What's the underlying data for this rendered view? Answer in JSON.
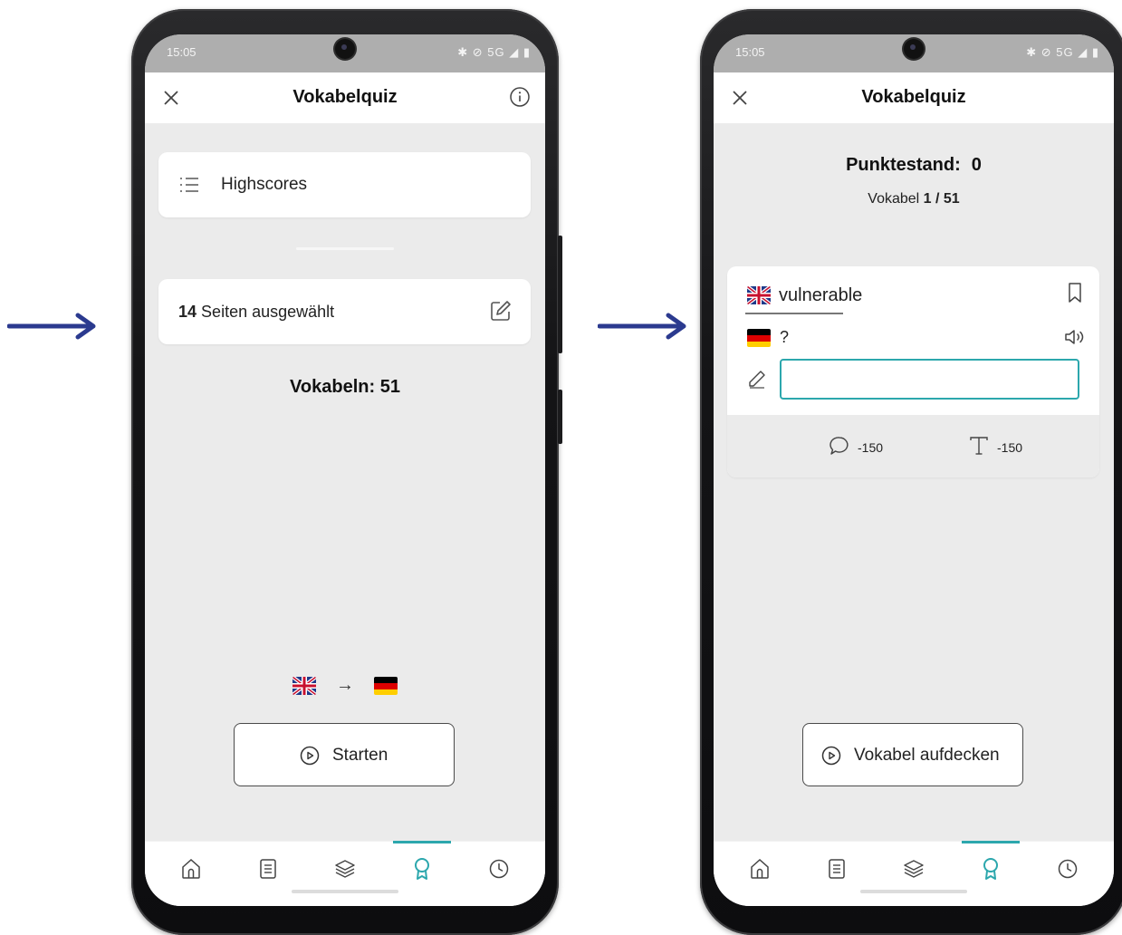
{
  "colors": {
    "accent": "#2ca7ad",
    "arrow": "#2b3a8f",
    "background": "#ebebeb",
    "status_bar": "#aeaeae"
  },
  "status_bar": {
    "time": "15:05",
    "icons": "✱ ⊘ 5G ◢ ▮"
  },
  "screen1": {
    "title": "Vokabelquiz",
    "highscores_label": "Highscores",
    "pages_count": "14",
    "pages_label": "Seiten ausgewählt",
    "vocab_count_label": "Vokabeln: 51",
    "direction_arrow": "→",
    "source_flag": "uk-flag",
    "target_flag": "de-flag",
    "start_label": "Starten"
  },
  "screen2": {
    "title": "Vokabelquiz",
    "score_label": "Punktestand:",
    "score_value": "0",
    "counter_prefix": "Vokabel",
    "counter_value": "1 / 51",
    "word": "vulnerable",
    "question_mark": "?",
    "answer_value": "",
    "hint_speech_cost": "-150",
    "hint_text_cost": "-150",
    "reveal_label": "Vokabel aufdecken"
  },
  "bottom_nav": {
    "items": [
      "home-icon",
      "list-icon",
      "layers-icon",
      "award-icon",
      "clock-icon"
    ],
    "active_index": 3
  }
}
